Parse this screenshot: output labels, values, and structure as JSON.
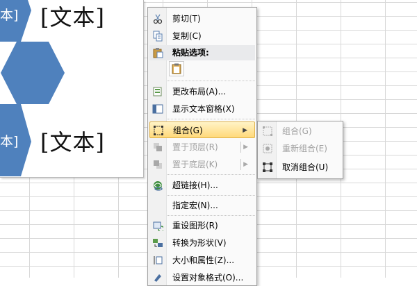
{
  "smartart": {
    "placeholder_top": "[文本]",
    "placeholder_bottom": "[文本]",
    "hex_label_top": "本]",
    "hex_label_bottom": "本]",
    "hex_color": "#4f81bd"
  },
  "context_menu": {
    "items": [
      {
        "label": "剪切(T)",
        "icon": "scissors-icon",
        "enabled": true
      },
      {
        "label": "复制(C)",
        "icon": "copy-icon",
        "enabled": true
      },
      {
        "label": "粘贴选项:",
        "icon": "paste-icon",
        "header": true
      },
      {
        "label": "",
        "icon": "paste-option-icon",
        "enabled": true
      },
      {
        "label": "更改布局(A)...",
        "icon": "change-layout-icon",
        "enabled": true
      },
      {
        "label": "显示文本窗格(X)",
        "icon": "text-pane-icon",
        "enabled": true
      },
      {
        "label": "组合(G)",
        "icon": "group-icon",
        "enabled": true,
        "submenu": true,
        "highlighted": true
      },
      {
        "label": "置于顶层(R)",
        "icon": "bring-to-front-icon",
        "enabled": false,
        "submenu": true
      },
      {
        "label": "置于底层(K)",
        "icon": "send-to-back-icon",
        "enabled": false,
        "submenu": true
      },
      {
        "label": "超链接(H)...",
        "icon": "hyperlink-icon",
        "enabled": true
      },
      {
        "label": "指定宏(N)...",
        "icon": "",
        "enabled": true
      },
      {
        "label": "重设图形(R)",
        "icon": "reset-graphic-icon",
        "enabled": true
      },
      {
        "label": "转换为形状(V)",
        "icon": "convert-to-shapes-icon",
        "enabled": true
      },
      {
        "label": "大小和属性(Z)...",
        "icon": "size-properties-icon",
        "enabled": true
      },
      {
        "label": "设置对象格式(O)...",
        "icon": "format-object-icon",
        "enabled": true
      }
    ]
  },
  "group_submenu": {
    "items": [
      {
        "label": "组合(G)",
        "icon": "group-icon",
        "enabled": false
      },
      {
        "label": "重新组合(E)",
        "icon": "regroup-icon",
        "enabled": false
      },
      {
        "label": "取消组合(U)",
        "icon": "ungroup-icon",
        "enabled": true
      }
    ]
  }
}
